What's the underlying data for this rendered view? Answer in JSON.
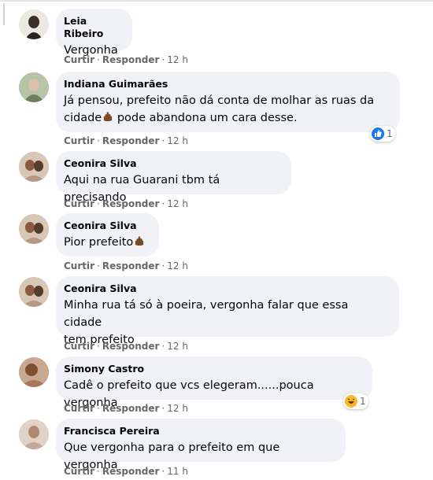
{
  "labels": {
    "like": "Curtir",
    "reply": "Responder"
  },
  "comments": [
    {
      "author": "Leia Ribeiro",
      "text": "Vergonha",
      "time": "12 h"
    },
    {
      "author": "Indiana Guimarães",
      "text1": "Já pensou, prefeito não dá conta de molhar as ruas da",
      "text2": "cidade",
      "text3": " pode abandona um cara desse.",
      "time": "12 h",
      "reaction": {
        "icon": "like-reaction-icon",
        "count": "1"
      }
    },
    {
      "author": "Ceonira Silva",
      "text": "Aqui na rua Guarani tbm tá precisando",
      "time": "12 h"
    },
    {
      "author": "Ceonira Silva",
      "text": "Pior prefeito",
      "time": "12 h"
    },
    {
      "author": "Ceonira Silva",
      "text1": "Minha rua tá só à poeira, vergonha falar que essa cidade",
      "text2": "tem prefeito",
      "time": "12 h"
    },
    {
      "author": "Simony Castro",
      "text": "Cadê o prefeito que vcs elegeram......pouca vergonha",
      "time": "12 h",
      "reaction": {
        "icon": "haha-reaction-icon",
        "count": "1"
      }
    },
    {
      "author": "Francisca Pereira",
      "text": "Que vergonha para o prefeito em que vergonha",
      "time": "11 h"
    }
  ],
  "colors": {
    "bubble": "#f0f2f5",
    "meta": "#65676b",
    "like_blue": "#1877f2",
    "haha_yellow": "#f7b928"
  }
}
